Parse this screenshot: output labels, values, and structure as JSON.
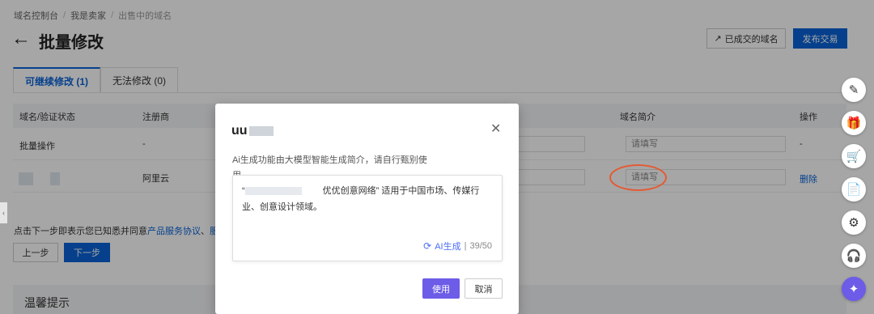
{
  "breadcrumb": [
    "域名控制台",
    "我是卖家",
    "出售中的域名"
  ],
  "page": {
    "title": "批量修改"
  },
  "header": {
    "done_button": "已成交的域名",
    "publish_button": "发布交易"
  },
  "tabs": [
    {
      "label": "可继续修改 (1)"
    },
    {
      "label": "无法修改 (0)"
    }
  ],
  "table": {
    "headers": {
      "domain": "域名/验证状态",
      "registrar": "注册商",
      "intro": "域名简介",
      "action": "操作"
    },
    "batch_row": {
      "label": "批量操作",
      "registrar": "-",
      "intro_placeholder": "请填写",
      "action": "-"
    },
    "row": {
      "registrar": "阿里云",
      "intro_placeholder": "请填写",
      "action": "删除"
    }
  },
  "footer": {
    "agree_text": "点击下一步即表示您已知悉并同意",
    "agree_link1": "产品服务协议",
    "agree_sep": "、",
    "agree_link2": "服务等",
    "prev": "上一步",
    "next": "下一步"
  },
  "tips": {
    "title": "温馨提示"
  },
  "modal": {
    "title_prefix": "uu",
    "description": "Ai生成功能由大模型智能生成简介，请自行甄别使用",
    "ai_text_open": "“",
    "ai_text_body": "优优创意网络” 适用于中国市场、传媒行业、创意设计领域。",
    "ai_generate": "AI生成",
    "ai_count": "39/50",
    "use_button": "使用",
    "cancel_button": "取消"
  },
  "colors": {
    "primary": "#0a63d8",
    "ai_purple": "#6c5ce7",
    "highlight": "#e45a34"
  },
  "toolbar_icons": [
    "edit-icon",
    "gift-icon",
    "cart-icon",
    "document-icon",
    "gear-icon",
    "headset-icon",
    "ai-assistant-icon"
  ]
}
